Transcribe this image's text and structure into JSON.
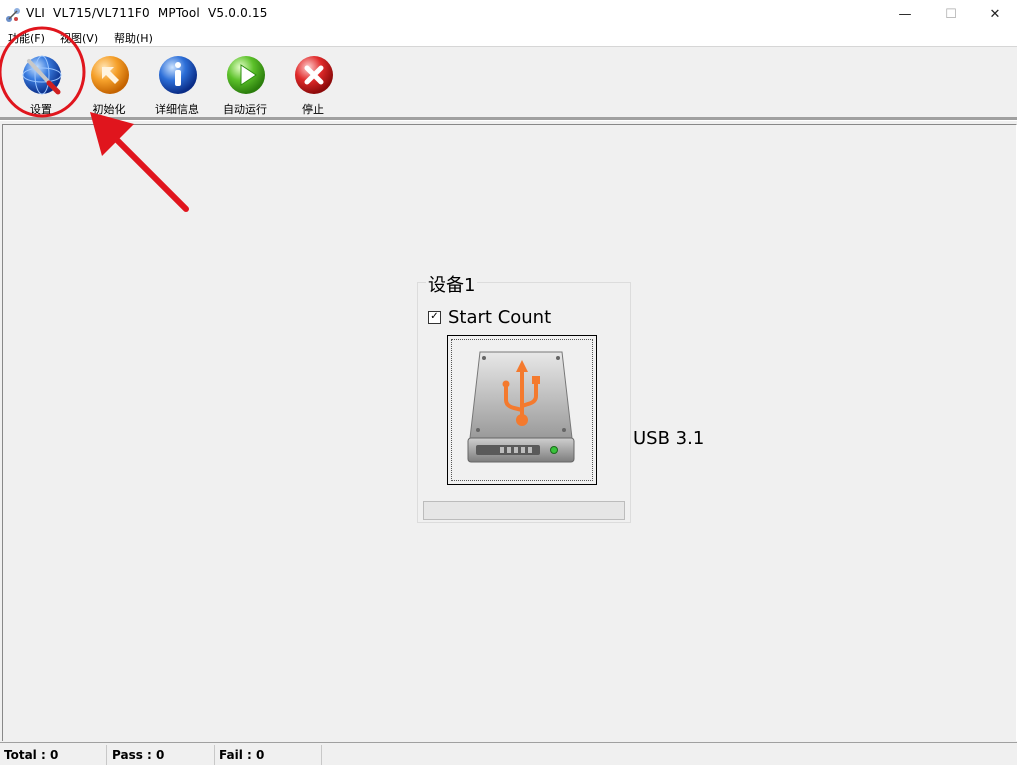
{
  "window": {
    "title": "VLI  VL715/VL711F0  MPTool  V5.0.0.15",
    "minimize_glyph": "—",
    "maximize_glyph": "☐",
    "close_glyph": "✕"
  },
  "menu": {
    "items": [
      {
        "label": "功能(F)"
      },
      {
        "label": "视图(V)"
      },
      {
        "label": "帮助(H)"
      }
    ]
  },
  "toolbar": {
    "buttons": [
      {
        "label": "设置",
        "icon": "settings-globe-icon"
      },
      {
        "label": "初始化",
        "icon": "init-arrow-icon"
      },
      {
        "label": "详细信息",
        "icon": "info-icon"
      },
      {
        "label": "自动运行",
        "icon": "play-icon"
      },
      {
        "label": "停止",
        "icon": "stop-icon"
      }
    ]
  },
  "device": {
    "group_title": "设备1",
    "checkbox_checked": true,
    "checkbox_label": "Start Count",
    "connection_type": "USB 3.1",
    "drive_icon": "usb-drive-icon",
    "progress": 0
  },
  "status": {
    "total": "Total : 0",
    "pass": "Pass : 0",
    "fail": "Fail : 0"
  },
  "colors": {
    "annotation_red": "#e0151d"
  }
}
